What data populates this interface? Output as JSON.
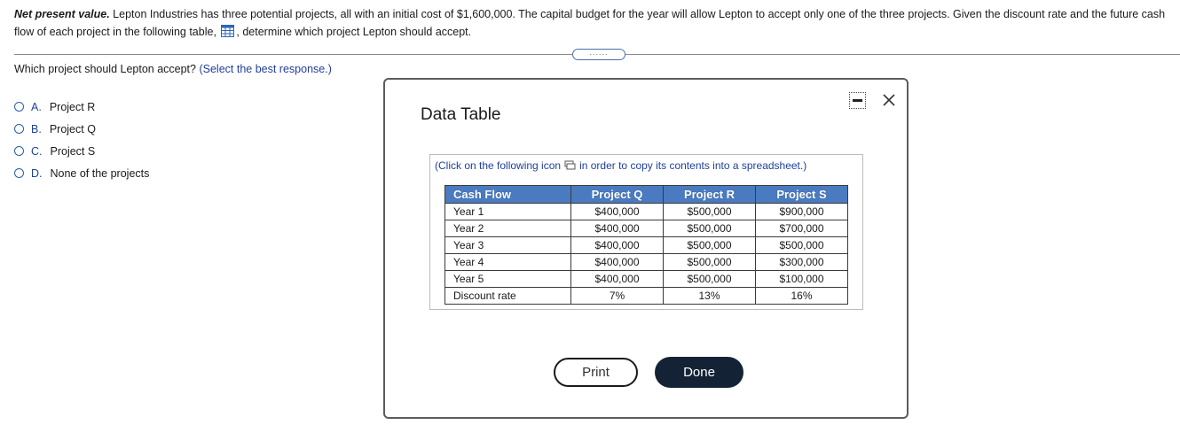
{
  "question": {
    "lead": "Net present value.",
    "body": " Lepton Industries has three potential projects, all with an initial cost of $1,600,000. The capital budget for the year will allow Lepton to accept only one of the three projects. Given the discount rate and the future cash flow of each project in the following table, ",
    "tail": ", determine which project Lepton should accept."
  },
  "more_button": "......",
  "prompt": {
    "text": "Which project should Lepton accept? ",
    "hint": "(Select the best response.)"
  },
  "options": [
    {
      "letter": "A.",
      "label": "Project R"
    },
    {
      "letter": "B.",
      "label": "Project Q"
    },
    {
      "letter": "C.",
      "label": "Project S"
    },
    {
      "letter": "D.",
      "label": "None of the projects"
    }
  ],
  "dialog": {
    "title": "Data Table",
    "copy_note_before": "(Click on the following icon",
    "copy_note_after": "in order to copy its contents into a spreadsheet.)",
    "headers": [
      "Cash Flow",
      "Project Q",
      "Project R",
      "Project S"
    ],
    "rows": [
      [
        "Year 1",
        "$400,000",
        "$500,000",
        "$900,000"
      ],
      [
        "Year 2",
        "$400,000",
        "$500,000",
        "$700,000"
      ],
      [
        "Year 3",
        "$400,000",
        "$500,000",
        "$500,000"
      ],
      [
        "Year 4",
        "$400,000",
        "$500,000",
        "$300,000"
      ],
      [
        "Year 5",
        "$400,000",
        "$500,000",
        "$100,000"
      ],
      [
        "Discount rate",
        "7%",
        "13%",
        "16%"
      ]
    ],
    "print_label": "Print",
    "done_label": "Done"
  },
  "colors": {
    "header_blue": "#4a7bc0",
    "link_blue": "#1f3f9c",
    "done_button": "#142236"
  },
  "icons": [
    "table-icon",
    "copy-icon",
    "minimize-icon",
    "close-icon",
    "radio-icon"
  ]
}
